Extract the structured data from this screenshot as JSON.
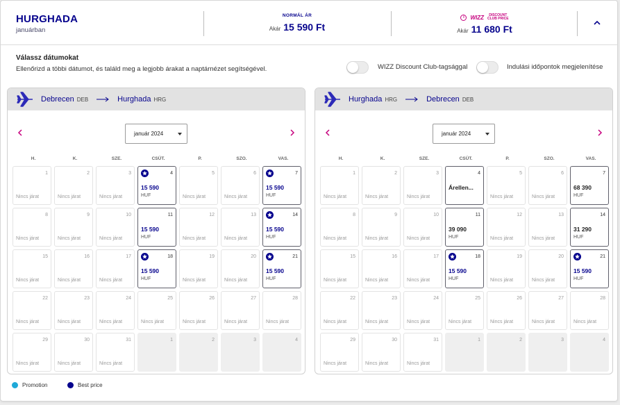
{
  "header": {
    "destination": "HURGHADA",
    "subtitle": "januárban",
    "normal_price_label": "NORMÁL ÁR",
    "from_label": "Akár",
    "normal_price": "15 590 Ft",
    "club_brand": "WIZZ",
    "club_sub_1": "DISCOUNT",
    "club_sub_2": "CLUB PRICE",
    "club_price": "11 680 Ft"
  },
  "options": {
    "title": "Válassz dátumokat",
    "description": "Ellenőrizd a többi dátumot, és találd meg a legjobb árakat a naptárnézet segítségével.",
    "toggle_club_label": "WIZZ Discount Club-tagsággal",
    "toggle_times_label": "Indulási időpontok megjelenítése"
  },
  "weekdays": [
    "H.",
    "K.",
    "SZE.",
    "CSÜT.",
    "P.",
    "SZO.",
    "VAS."
  ],
  "no_flight": "Nincs járat",
  "calendars": [
    {
      "from_city": "Debrecen",
      "from_code": "DEB",
      "to_city": "Hurghada",
      "to_code": "HRG",
      "month": "január 2024",
      "days": [
        {
          "day": "1"
        },
        {
          "day": "2"
        },
        {
          "day": "3"
        },
        {
          "day": "4",
          "price": "15 590",
          "currency": "HUF",
          "best": true
        },
        {
          "day": "5"
        },
        {
          "day": "6"
        },
        {
          "day": "7",
          "price": "15 590",
          "currency": "HUF",
          "best": true
        },
        {
          "day": "8"
        },
        {
          "day": "9"
        },
        {
          "day": "10"
        },
        {
          "day": "11",
          "price": "15 590",
          "currency": "HUF",
          "best": false
        },
        {
          "day": "12"
        },
        {
          "day": "13"
        },
        {
          "day": "14",
          "price": "15 590",
          "currency": "HUF",
          "best": true
        },
        {
          "day": "15"
        },
        {
          "day": "16"
        },
        {
          "day": "17"
        },
        {
          "day": "18",
          "price": "15 590",
          "currency": "HUF",
          "best": true
        },
        {
          "day": "19"
        },
        {
          "day": "20"
        },
        {
          "day": "21",
          "price": "15 590",
          "currency": "HUF",
          "best": true
        },
        {
          "day": "22"
        },
        {
          "day": "23"
        },
        {
          "day": "24"
        },
        {
          "day": "25"
        },
        {
          "day": "26"
        },
        {
          "day": "27"
        },
        {
          "day": "28"
        },
        {
          "day": "29"
        },
        {
          "day": "30"
        },
        {
          "day": "31"
        },
        {
          "day": "1",
          "outside": true
        },
        {
          "day": "2",
          "outside": true
        },
        {
          "day": "3",
          "outside": true
        },
        {
          "day": "4",
          "outside": true
        }
      ]
    },
    {
      "from_city": "Hurghada",
      "from_code": "HRG",
      "to_city": "Debrecen",
      "to_code": "DEB",
      "month": "január 2024",
      "days": [
        {
          "day": "1"
        },
        {
          "day": "2"
        },
        {
          "day": "3"
        },
        {
          "day": "4",
          "price": "Árellen...",
          "dark": true
        },
        {
          "day": "5"
        },
        {
          "day": "6"
        },
        {
          "day": "7",
          "price": "68 390",
          "currency": "HUF",
          "dark": true
        },
        {
          "day": "8"
        },
        {
          "day": "9"
        },
        {
          "day": "10"
        },
        {
          "day": "11",
          "price": "39 090",
          "currency": "HUF",
          "dark": true
        },
        {
          "day": "12"
        },
        {
          "day": "13"
        },
        {
          "day": "14",
          "price": "31 290",
          "currency": "HUF",
          "dark": true
        },
        {
          "day": "15"
        },
        {
          "day": "16"
        },
        {
          "day": "17"
        },
        {
          "day": "18",
          "price": "15 590",
          "currency": "HUF",
          "best": true
        },
        {
          "day": "19"
        },
        {
          "day": "20"
        },
        {
          "day": "21",
          "price": "15 590",
          "currency": "HUF",
          "best": true
        },
        {
          "day": "22"
        },
        {
          "day": "23"
        },
        {
          "day": "24"
        },
        {
          "day": "25"
        },
        {
          "day": "26"
        },
        {
          "day": "27"
        },
        {
          "day": "28"
        },
        {
          "day": "29"
        },
        {
          "day": "30"
        },
        {
          "day": "31"
        },
        {
          "day": "1",
          "outside": true
        },
        {
          "day": "2",
          "outside": true
        },
        {
          "day": "3",
          "outside": true
        },
        {
          "day": "4",
          "outside": true
        }
      ]
    }
  ],
  "legend": {
    "promotion_label": "Promotion",
    "best_price_label": "Best price"
  },
  "colors": {
    "brand_navy": "#06038d",
    "brand_magenta": "#c6007e",
    "promotion_cyan": "#1fa9d8"
  }
}
